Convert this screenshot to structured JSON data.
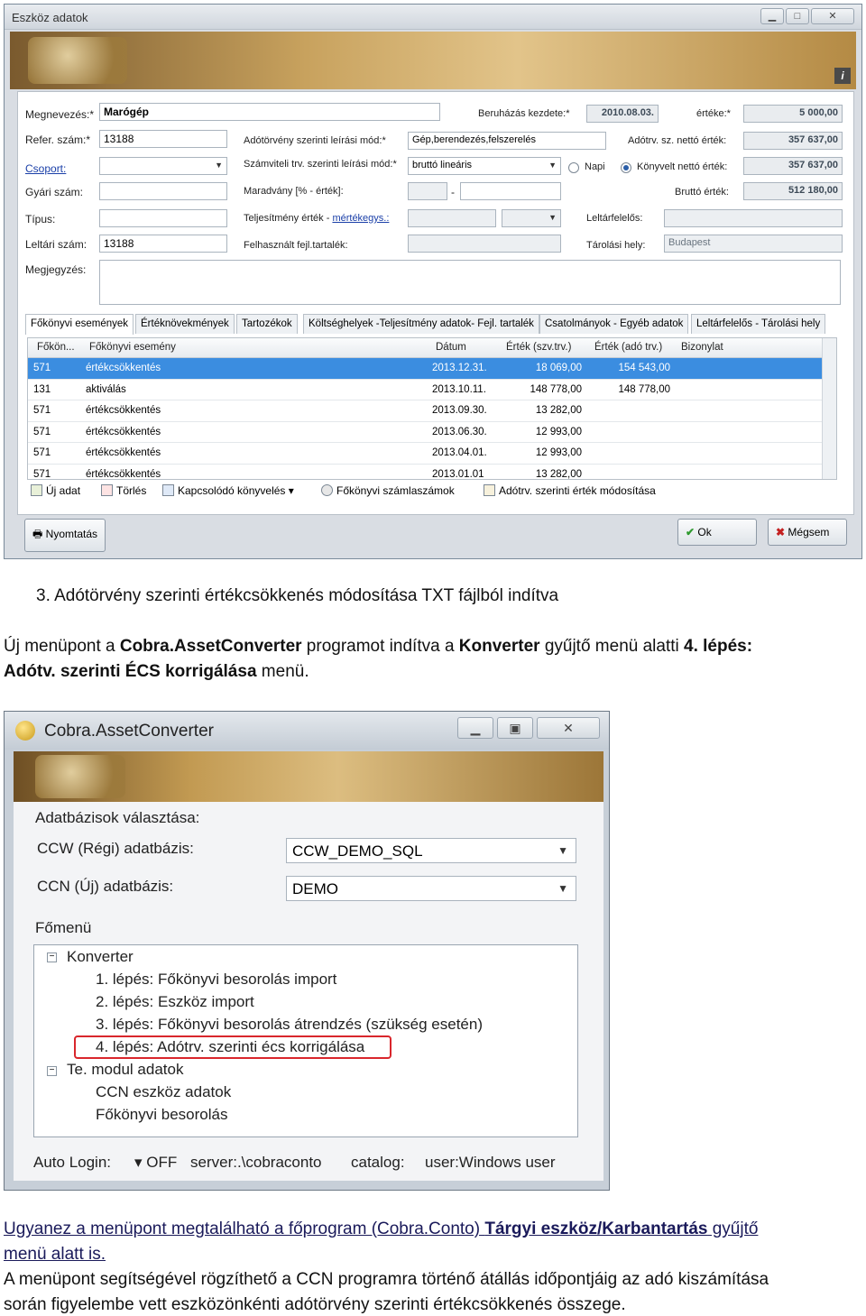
{
  "window1": {
    "title": "Eszköz adatok",
    "form": {
      "megnevezes_label": "Megnevezés:*",
      "megnevezes_value": "Marógép",
      "refer_label": "Refer. szám:*",
      "refer_value": "13188",
      "csoport_label": "Csoport:",
      "gyari_label": "Gyári szám:",
      "tipus_label": "Típus:",
      "leltari_label": "Leltári szám:",
      "leltari_value": "13188",
      "megjegyzes_label": "Megjegyzés:",
      "adotv_mod_label": "Adótörvény szerinti leírási mód:*",
      "adotv_mod_value": "Gép,berendezés,felszerelés",
      "szamv_mod_label": "Számviteli trv. szerinti leírási mód:*",
      "szamv_mod_value": "bruttó lineáris",
      "maradvany_label": "Maradvány [% - érték]:",
      "maradvany_sep": "-",
      "teljesitmeny_label": "Teljesítmény érték -",
      "mertekegys_link": "mértékegys.:",
      "felhasznalt_label": "Felhasznált fejl.tartalék:",
      "beruhazas_label": "Beruházás kezdete:*",
      "beruhazas_value": "2010.08.03.",
      "erteke_label": "értéke:*",
      "erteke_value": "5 000,00",
      "adotv_netto_label": "Adótrv. sz. nettó érték:",
      "adotv_netto_value": "357 637,00",
      "napi_label": "Napi",
      "konyvelt_label": "Könyvelt nettó érték:",
      "konyvelt_value": "357 637,00",
      "brutto_label": "Bruttó érték:",
      "brutto_value": "512 180,00",
      "leltarfelelos_label": "Leltárfelelős:",
      "tarolasi_label": "Tárolási hely:",
      "tarolasi_value": "Budapest"
    },
    "tabs": [
      "Főkönyvi események",
      "Értéknövekmények",
      "Tartozékok",
      "Költséghelyek -Teljesítmény adatok- Fejl. tartalék",
      "Csatolmányok - Egyéb adatok",
      "Leltárfelelős - Tárolási hely"
    ],
    "grid": {
      "headers": [
        "Főkön...",
        "Főkönyvi esemény",
        "Dátum",
        "Érték (szv.trv.)",
        "Érték (adó trv.)",
        "Bizonylat"
      ],
      "rows": [
        [
          "571",
          "értékcsökkentés",
          "2013.12.31.",
          "18 069,00",
          "154 543,00",
          ""
        ],
        [
          "131",
          "aktiválás",
          "2013.10.11.",
          "148 778,00",
          "148 778,00",
          ""
        ],
        [
          "571",
          "értékcsökkentés",
          "2013.09.30.",
          "13 282,00",
          "",
          ""
        ],
        [
          "571",
          "értékcsökkentés",
          "2013.06.30.",
          "12 993,00",
          "",
          ""
        ],
        [
          "571",
          "értékcsökkentés",
          "2013.04.01.",
          "12 993,00",
          "",
          ""
        ],
        [
          "571",
          "értékcsökkentés",
          "2013.01.01",
          "13 282,00",
          "",
          ""
        ]
      ]
    },
    "toolbar": {
      "uj": "Új adat",
      "torles": "Törlés",
      "kapcsolodo": "Kapcsolódó könyvelés",
      "fokonyvi_szamla": "Főkönyvi számlaszámok",
      "adotv_mod": "Adótrv. szerinti érték módosítása"
    },
    "buttons": {
      "nyomtatas": "Nyomtatás",
      "ok": "Ok",
      "megsem": "Mégsem"
    }
  },
  "text": {
    "heading": "3.   Adótörvény szerinti értékcsökkenés módosítása TXT fájlból indítva",
    "p1_a": "Új menüpont a ",
    "p1_b": "Cobra.AssetConverter",
    "p1_c": " programot indítva a ",
    "p1_d": "Konverter",
    "p1_e": " gyűjtő menü alatti ",
    "p1_f": "4. lépés:",
    "p1_g": "Adótv. szerinti ÉCS korrigálása",
    "p1_h": " menü.",
    "p2_a": "Ugyanez a menüpont megtalálható a főprogram (Cobra.Conto) ",
    "p2_b": "Tárgyi eszköz/Karbantartás",
    "p2_c": " gyűjtő",
    "p2_d": "menü alatt is.",
    "p3_a": "A menüpont segítségével rögzíthető a CCN programra történő átállás időpontjáig az adó kiszámítása",
    "p3_b": "során figyelembe vett eszközönkénti adótörvény szerinti értékcsökkenés összege."
  },
  "window2": {
    "title": "Cobra.AssetConverter",
    "db_section": "Adatbázisok választása:",
    "ccw_label": "CCW (Régi) adatbázis:",
    "ccw_value": "CCW_DEMO_SQL",
    "ccn_label": "CCN (Új) adatbázis:",
    "ccn_value": "DEMO",
    "menu_section": "Főmenü",
    "tree": {
      "konverter": "Konverter",
      "step1": "1. lépés: Főkönyvi besorolás import",
      "step2": "2. lépés: Eszköz import",
      "step3": "3. lépés: Főkönyvi besorolás átrendzés (szükség esetén)",
      "step4": "4. lépés: Adótrv. szerinti écs korrigálása",
      "modul": "Te. modul adatok",
      "ccn_eszkoz": "CCN eszköz adatok",
      "fokonyvi": "Főkönyvi besorolás"
    },
    "status": {
      "autologin": "Auto Login:",
      "off": "OFF",
      "server": "server:.\\cobraconto",
      "catalog": "catalog:",
      "user": "user:Windows user"
    }
  }
}
